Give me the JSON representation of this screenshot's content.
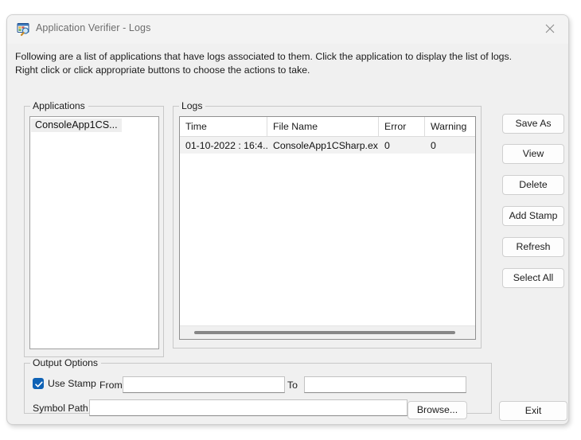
{
  "window": {
    "title": "Application Verifier - Logs",
    "icon": "app-verifier-icon",
    "close_icon": "close-icon"
  },
  "description": "Following are a list of applications that have logs associated to them. Click the application to display the list of logs. Right click or click appropriate buttons to choose the actions to take.",
  "applications": {
    "group_label": "Applications",
    "items": [
      {
        "label": "ConsoleApp1CS..."
      }
    ]
  },
  "logs": {
    "group_label": "Logs",
    "columns": [
      "Time",
      "File Name",
      "Error",
      "Warning"
    ],
    "rows": [
      {
        "time": "01-10-2022 : 16:4...",
        "file_name": "ConsoleApp1CSharp.ex...",
        "error": "0",
        "warning": "0"
      }
    ],
    "scrollbar": "horizontal-scrollbar"
  },
  "side_buttons": [
    {
      "id": "btn-save-as",
      "label": "Save As"
    },
    {
      "id": "btn-view",
      "label": "View"
    },
    {
      "id": "btn-delete",
      "label": "Delete"
    },
    {
      "id": "btn-add-stamp",
      "label": "Add Stamp"
    },
    {
      "id": "btn-refresh",
      "label": "Refresh"
    },
    {
      "id": "btn-select-all",
      "label": "Select All"
    }
  ],
  "output_options": {
    "group_label": "Output Options",
    "use_stamp": {
      "label": "Use Stamp",
      "checked": true
    },
    "from": {
      "label": "From",
      "value": "",
      "placeholder": ""
    },
    "to": {
      "label": "To",
      "value": "",
      "placeholder": ""
    },
    "symbol_path": {
      "label": "Symbol Path",
      "value": "",
      "placeholder": ""
    },
    "browse_label": "Browse..."
  },
  "exit_label": "Exit",
  "colors": {
    "dialog_bg": "#f0f0f0",
    "titlebar_bg": "#f3f3f3",
    "accent": "#0f62b5",
    "title_text": "#6d6d6d",
    "border": "#c8c8c8"
  }
}
